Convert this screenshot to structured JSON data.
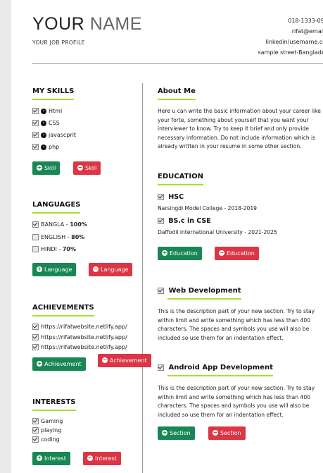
{
  "header": {
    "first_name": "YOUR",
    "last_name": "NAME",
    "profile": "YOUR JOB PROFILE",
    "phone": "018-1333-0990",
    "email": "rifat@email.in",
    "linkedin": "linkedin/username.com",
    "address": "sample street-Bangladesh"
  },
  "skills": {
    "title": "MY SKILLS",
    "items": [
      "Html",
      "CSS",
      "javascprit",
      "php"
    ],
    "add_label": "Skill",
    "remove_label": "Skill"
  },
  "languages": {
    "title": "LANGUAGES",
    "items": [
      {
        "name": "BANGLA - ",
        "level": "100%",
        "checked": true
      },
      {
        "name": "ENGLISH - ",
        "level": "80%",
        "checked": false
      },
      {
        "name": "HINDI - ",
        "level": "70%",
        "checked": false
      }
    ],
    "add_label": "Language",
    "remove_label": "Language"
  },
  "achievements": {
    "title": "ACHIEVEMENTS",
    "items": [
      "https://rifatwebsite.netlify.app/",
      "https://rifatwebsite.netlify.app/",
      "https://rifatwebsite.netlify.app/"
    ],
    "add_label": "Achievement",
    "remove_label": "Achievement"
  },
  "interests": {
    "title": "INTERESTS",
    "items": [
      "Gaming",
      "playing",
      "coding"
    ],
    "add_label": "Interest",
    "remove_label": "Interest"
  },
  "about": {
    "title": "About Me",
    "text": "Here u can write the basic information about your career like your forte, something about yourself that you want your interviewer to know. Try to keep it brief and only provide necessary information. Do not include information which is already written in your resume in some other section."
  },
  "education": {
    "title": "EDUCATION",
    "items": [
      {
        "degree": "HSC",
        "school": "Narsingdi Model College  - 2018-2019"
      },
      {
        "degree": "BS.c in CSE",
        "school": "Daffodil international University - 2021-2025"
      }
    ],
    "add_label": "Education",
    "remove_label": "Education"
  },
  "sections": {
    "items": [
      {
        "title": "Web Development",
        "text": "This is the description part of your new section. Try to stay within limit and write something which has less than 400 characters. The spaces and symbols you use will also be included so use them for an indentation effect."
      },
      {
        "title": "Android App Development",
        "text": "This is the description part of your new section. Try to stay within limit and write something which has less than 400 characters. The spaces and symbols you use will also be included so use them for an indentation effect."
      }
    ],
    "add_label": "Section",
    "remove_label": "Section"
  },
  "colors": {
    "accent_underline": "#a6e22e",
    "add_button": "#198754",
    "remove_button": "#dc3545"
  }
}
